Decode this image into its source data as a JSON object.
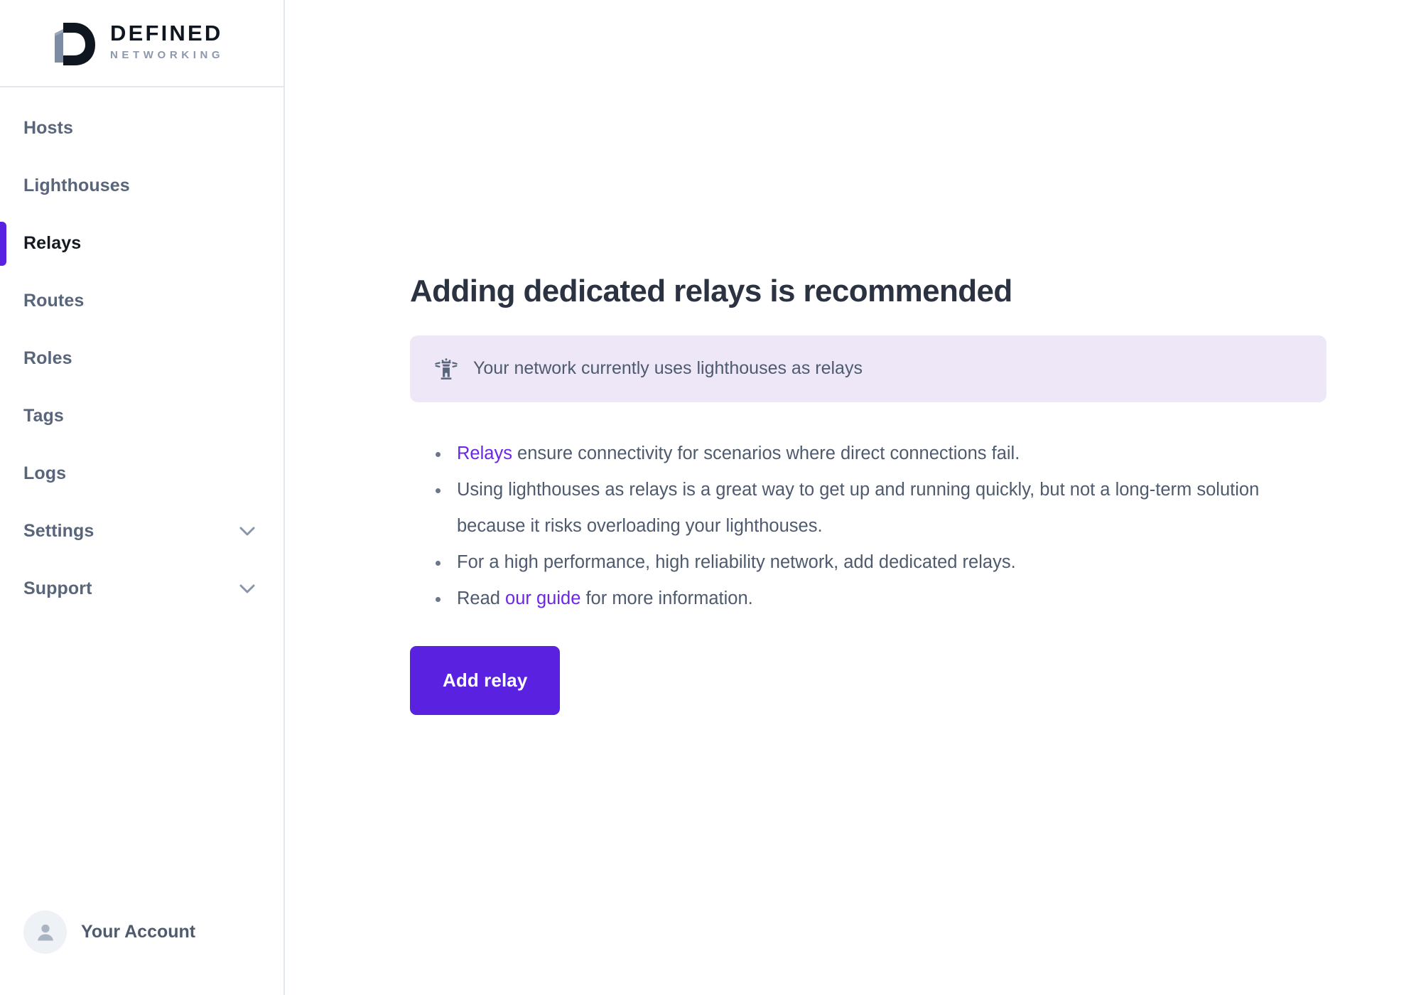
{
  "brand": {
    "name_line1": "DEFINED",
    "name_line2": "NETWORKING",
    "logo_icon": "defined-networking-d-mark",
    "logo_dark_color": "#10161f",
    "logo_accent_color": "#8b98ad"
  },
  "sidebar": {
    "items": [
      {
        "label": "Hosts",
        "active": false,
        "expandable": false
      },
      {
        "label": "Lighthouses",
        "active": false,
        "expandable": false
      },
      {
        "label": "Relays",
        "active": true,
        "expandable": false
      },
      {
        "label": "Routes",
        "active": false,
        "expandable": false
      },
      {
        "label": "Roles",
        "active": false,
        "expandable": false
      },
      {
        "label": "Tags",
        "active": false,
        "expandable": false
      },
      {
        "label": "Logs",
        "active": false,
        "expandable": false
      },
      {
        "label": "Settings",
        "active": false,
        "expandable": true,
        "chevron_icon": "chevron-down-icon"
      },
      {
        "label": "Support",
        "active": false,
        "expandable": true,
        "chevron_icon": "chevron-down-icon"
      }
    ],
    "account": {
      "label": "Your Account",
      "avatar_icon": "user-avatar-icon"
    },
    "active_indicator_color": "#5a22e0"
  },
  "main": {
    "title": "Adding dedicated relays is recommended",
    "banner": {
      "icon": "lighthouse-icon",
      "text": "Your network currently uses lighthouses as relays",
      "background_color": "#ede7f8"
    },
    "bullets": [
      {
        "link_leading": "Relays",
        "text": " ensure connectivity for scenarios where direct connections fail."
      },
      {
        "text": "Using lighthouses as relays is a great way to get up and running quickly, but not a long-term solution because it risks overloading your lighthouses."
      },
      {
        "text": "For a high performance, high reliability network, add dedicated relays."
      },
      {
        "text_before": "Read ",
        "link": "our guide",
        "text_after": " for more information."
      }
    ],
    "primary_button": {
      "label": "Add relay",
      "background_color": "#5a22e0",
      "text_color": "#ffffff"
    },
    "link_color": "#6b26e6",
    "body_text_color": "#4e5a6e"
  }
}
